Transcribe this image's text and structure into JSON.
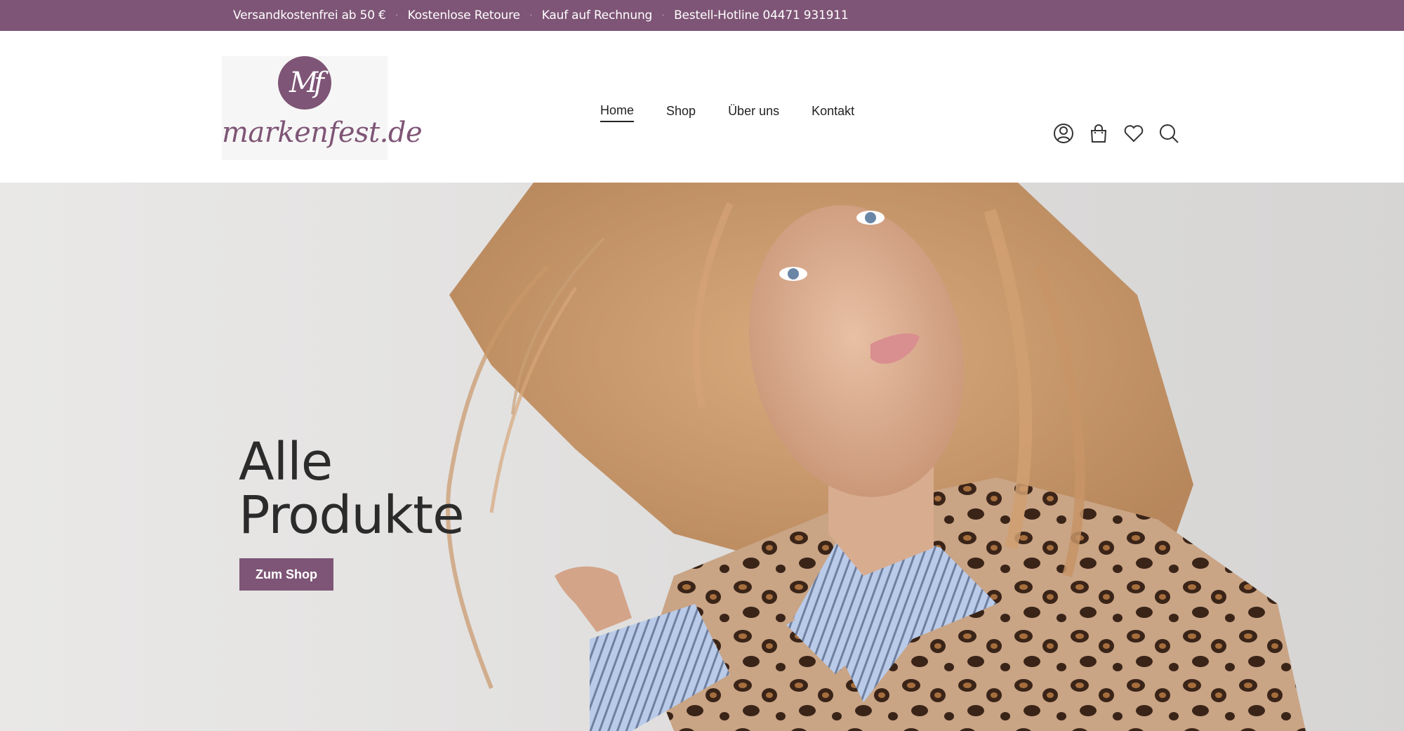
{
  "topbar": {
    "items": [
      "Versandkostenfrei ab 50 €",
      "Kostenlose Retoure",
      "Kauf auf Rechnung",
      "Bestell-Hotline 04471 931911"
    ],
    "separator": "·"
  },
  "logo": {
    "monogram": "Mf",
    "wordmark": "markenfest.de"
  },
  "nav": {
    "items": [
      {
        "label": "Home",
        "active": true
      },
      {
        "label": "Shop",
        "active": false
      },
      {
        "label": "Über uns",
        "active": false
      },
      {
        "label": "Kontakt",
        "active": false
      }
    ]
  },
  "header_icons": [
    "account-icon",
    "cart-icon",
    "wishlist-heart-icon",
    "search-icon"
  ],
  "hero": {
    "title_line1": "Alle",
    "title_line2": "Produkte",
    "button_label": "Zum Shop"
  },
  "colors": {
    "brand": "#7e5576",
    "text_dark": "#2b2b2b",
    "hero_bg": "#e4e3e2"
  }
}
